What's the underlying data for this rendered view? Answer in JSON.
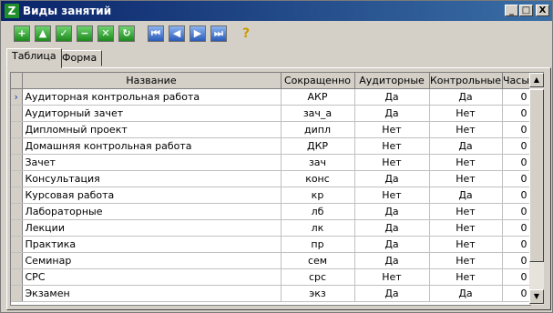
{
  "window": {
    "title": "Виды занятий",
    "app_icon": "Z",
    "controls": [
      "_",
      "□",
      "X"
    ]
  },
  "toolbar": {
    "buttons": [
      {
        "icon": "add-icon",
        "glyph": "+"
      },
      {
        "icon": "move-up-icon",
        "glyph": "▲"
      },
      {
        "icon": "check-icon",
        "glyph": "✓"
      },
      {
        "icon": "remove-icon",
        "glyph": "−"
      },
      {
        "icon": "cancel-icon",
        "glyph": "✕"
      },
      {
        "icon": "refresh-icon",
        "glyph": "↻"
      },
      {
        "icon": "first-record-icon",
        "glyph": "⏮"
      },
      {
        "icon": "prior-record-icon",
        "glyph": "◀"
      },
      {
        "icon": "next-record-icon",
        "glyph": "▶"
      },
      {
        "icon": "last-record-icon",
        "glyph": "⏭"
      },
      {
        "icon": "help-icon",
        "glyph": "?"
      }
    ]
  },
  "tabs": [
    "Таблица",
    "Форма"
  ],
  "table": {
    "columns": [
      "Название",
      "Сокращенно",
      "Аудиторные",
      "Контрольные",
      "Часы"
    ],
    "current_row_marker": "›",
    "rows": [
      [
        "Аудиторная контрольная работа",
        "АКР",
        "Да",
        "Да",
        "0"
      ],
      [
        "Аудиторный зачет",
        "зач_а",
        "Да",
        "Нет",
        "0"
      ],
      [
        "Дипломный проект",
        "дипл",
        "Нет",
        "Нет",
        "0"
      ],
      [
        "Домашняя контрольная работа",
        "ДКР",
        "Нет",
        "Да",
        "0"
      ],
      [
        "Зачет",
        "зач",
        "Нет",
        "Нет",
        "0"
      ],
      [
        "Консультация",
        "конс",
        "Да",
        "Нет",
        "0"
      ],
      [
        "Курсовая работа",
        "кр",
        "Нет",
        "Да",
        "0"
      ],
      [
        "Лабораторные",
        "лб",
        "Да",
        "Нет",
        "0"
      ],
      [
        "Лекции",
        "лк",
        "Да",
        "Нет",
        "0"
      ],
      [
        "Практика",
        "пр",
        "Да",
        "Нет",
        "0"
      ],
      [
        "Семинар",
        "сем",
        "Да",
        "Нет",
        "0"
      ],
      [
        "СРС",
        "срс",
        "Нет",
        "Нет",
        "0"
      ],
      [
        "Экзамен",
        "экз",
        "Да",
        "Да",
        "0"
      ]
    ]
  }
}
